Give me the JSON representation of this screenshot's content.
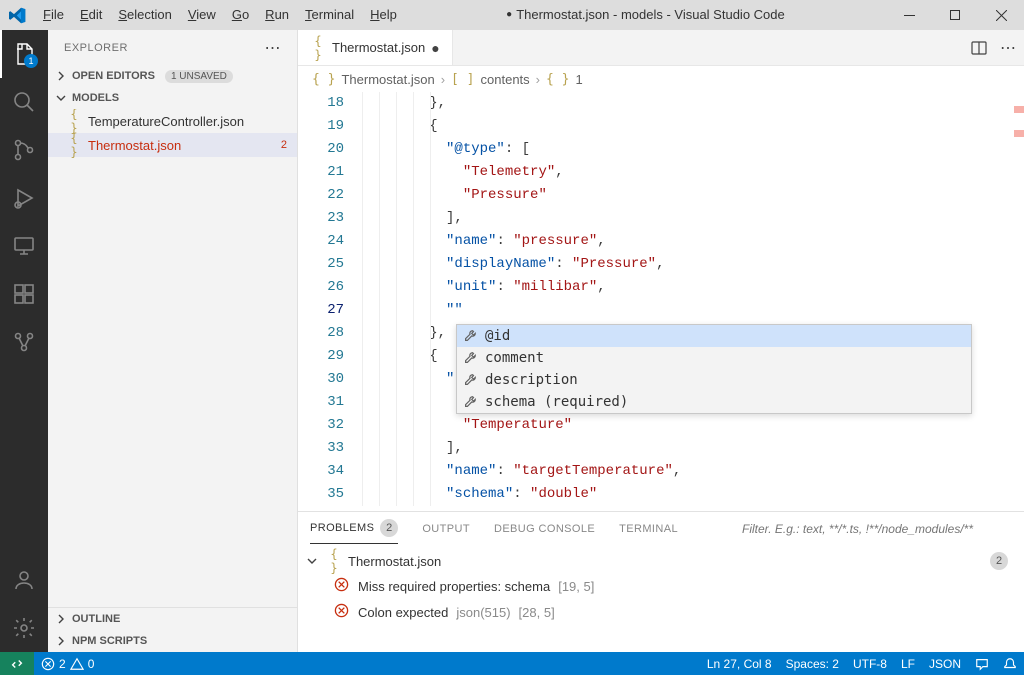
{
  "menu": [
    "File",
    "Edit",
    "Selection",
    "View",
    "Go",
    "Run",
    "Terminal",
    "Help"
  ],
  "title": "Thermostat.json - models - Visual Studio Code",
  "sidebar": {
    "header": "EXPLORER",
    "open_editors": "OPEN EDITORS",
    "unsaved_badge": "1 UNSAVED",
    "folder": "MODELS",
    "files": [
      {
        "name": "TemperatureController.json",
        "error": false,
        "selected": false,
        "badge": ""
      },
      {
        "name": "Thermostat.json",
        "error": true,
        "selected": true,
        "badge": "2"
      }
    ],
    "outline": "OUTLINE",
    "npm": "NPM SCRIPTS"
  },
  "tab": {
    "name": "Thermostat.json"
  },
  "breadcrumbs": [
    "Thermostat.json",
    "contents",
    "1"
  ],
  "code": {
    "start": 18,
    "lines_html": [
      "        <span class='tok-punc'>},</span>",
      "        <span class='tok-punc'>{</span>",
      "          <span class='tok-key'>\"@type\"</span><span class='tok-punc'>: [</span>",
      "            <span class='tok-str'>\"Telemetry\"</span><span class='tok-punc'>,</span>",
      "            <span class='tok-str'>\"Pressure\"</span>",
      "          <span class='tok-punc'>],</span>",
      "          <span class='tok-key'>\"name\"</span><span class='tok-punc'>: </span><span class='tok-str'>\"pressure\"</span><span class='tok-punc'>,</span>",
      "          <span class='tok-key'>\"displayName\"</span><span class='tok-punc'>: </span><span class='tok-str'>\"Pressure\"</span><span class='tok-punc'>,</span>",
      "          <span class='tok-key'>\"unit\"</span><span class='tok-punc'>: </span><span class='tok-str'>\"millibar\"</span><span class='tok-punc'>,</span>",
      "          <span class='tok-key'>\"\"</span>",
      "        <span class='tok-punc'>},</span>",
      "        <span class='tok-punc'>{</span>",
      "          <span class='tok-key'>\"</span>",
      "          ",
      "            <span class='tok-str'>\"Temperature\"</span>",
      "          <span class='tok-punc'>],</span>",
      "          <span class='tok-key'>\"name\"</span><span class='tok-punc'>: </span><span class='tok-str'>\"targetTemperature\"</span><span class='tok-punc'>,</span>",
      "          <span class='tok-key'>\"schema\"</span><span class='tok-punc'>: </span><span class='tok-str'>\"double\"</span>"
    ],
    "active_line": 27
  },
  "suggest": [
    {
      "label": "@id",
      "selected": true
    },
    {
      "label": "comment",
      "selected": false
    },
    {
      "label": "description",
      "selected": false
    },
    {
      "label": "schema (required)",
      "selected": false
    }
  ],
  "panel": {
    "tabs": [
      "PROBLEMS",
      "OUTPUT",
      "DEBUG CONSOLE",
      "TERMINAL"
    ],
    "problems_count": "2",
    "filter_placeholder": "Filter. E.g.: text, **/*.ts, !**/node_modules/**",
    "file": "Thermostat.json",
    "file_badge": "2",
    "items": [
      {
        "msg": "Miss required properties: schema",
        "pos": "[19, 5]"
      },
      {
        "msg": "Colon expected",
        "code": "json(515)",
        "pos": "[28, 5]"
      }
    ]
  },
  "status": {
    "errors": "2",
    "warnings": "0",
    "cursor": "Ln 27, Col 8",
    "spaces": "Spaces: 2",
    "encoding": "UTF-8",
    "eol": "LF",
    "lang": "JSON"
  }
}
